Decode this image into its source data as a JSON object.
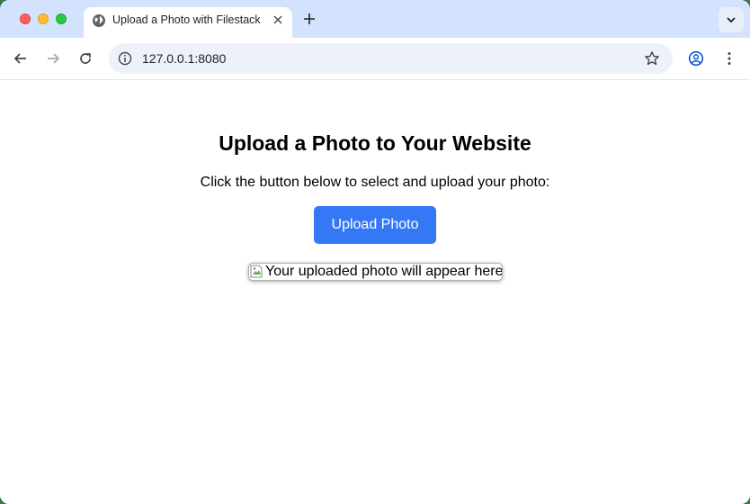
{
  "browser": {
    "tab": {
      "title": "Upload a Photo with Filestack",
      "favicon": "globe-icon"
    },
    "address_bar": {
      "url": "127.0.0.1:8080"
    },
    "colors": {
      "tabstrip": "#d3e3fd",
      "omnibox": "#edf2fa"
    }
  },
  "page": {
    "heading": "Upload a Photo to Your Website",
    "instruction": "Click the button below to select and upload your photo:",
    "upload_button_label": "Upload Photo",
    "photo_alt_text": "Your uploaded photo will appear here",
    "colors": {
      "button": "#3478f6",
      "button_text": "#ffffff"
    }
  }
}
